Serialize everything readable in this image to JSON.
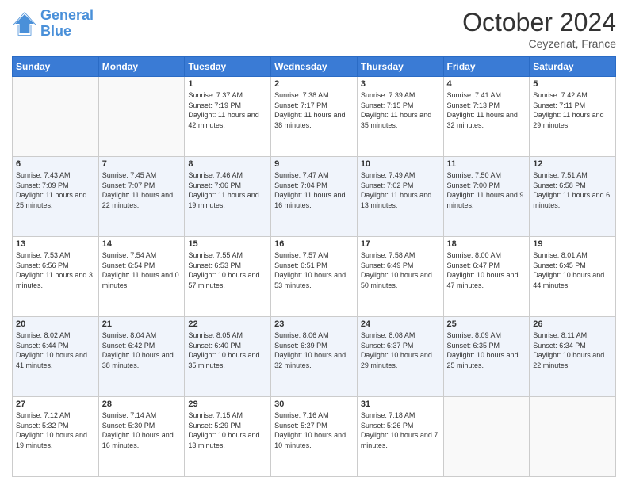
{
  "header": {
    "logo_line1": "General",
    "logo_line2": "Blue",
    "month": "October 2024",
    "location": "Ceyzeriat, France"
  },
  "weekdays": [
    "Sunday",
    "Monday",
    "Tuesday",
    "Wednesday",
    "Thursday",
    "Friday",
    "Saturday"
  ],
  "weeks": [
    [
      {
        "day": "",
        "sunrise": "",
        "sunset": "",
        "daylight": ""
      },
      {
        "day": "",
        "sunrise": "",
        "sunset": "",
        "daylight": ""
      },
      {
        "day": "1",
        "sunrise": "Sunrise: 7:37 AM",
        "sunset": "Sunset: 7:19 PM",
        "daylight": "Daylight: 11 hours and 42 minutes."
      },
      {
        "day": "2",
        "sunrise": "Sunrise: 7:38 AM",
        "sunset": "Sunset: 7:17 PM",
        "daylight": "Daylight: 11 hours and 38 minutes."
      },
      {
        "day": "3",
        "sunrise": "Sunrise: 7:39 AM",
        "sunset": "Sunset: 7:15 PM",
        "daylight": "Daylight: 11 hours and 35 minutes."
      },
      {
        "day": "4",
        "sunrise": "Sunrise: 7:41 AM",
        "sunset": "Sunset: 7:13 PM",
        "daylight": "Daylight: 11 hours and 32 minutes."
      },
      {
        "day": "5",
        "sunrise": "Sunrise: 7:42 AM",
        "sunset": "Sunset: 7:11 PM",
        "daylight": "Daylight: 11 hours and 29 minutes."
      }
    ],
    [
      {
        "day": "6",
        "sunrise": "Sunrise: 7:43 AM",
        "sunset": "Sunset: 7:09 PM",
        "daylight": "Daylight: 11 hours and 25 minutes."
      },
      {
        "day": "7",
        "sunrise": "Sunrise: 7:45 AM",
        "sunset": "Sunset: 7:07 PM",
        "daylight": "Daylight: 11 hours and 22 minutes."
      },
      {
        "day": "8",
        "sunrise": "Sunrise: 7:46 AM",
        "sunset": "Sunset: 7:06 PM",
        "daylight": "Daylight: 11 hours and 19 minutes."
      },
      {
        "day": "9",
        "sunrise": "Sunrise: 7:47 AM",
        "sunset": "Sunset: 7:04 PM",
        "daylight": "Daylight: 11 hours and 16 minutes."
      },
      {
        "day": "10",
        "sunrise": "Sunrise: 7:49 AM",
        "sunset": "Sunset: 7:02 PM",
        "daylight": "Daylight: 11 hours and 13 minutes."
      },
      {
        "day": "11",
        "sunrise": "Sunrise: 7:50 AM",
        "sunset": "Sunset: 7:00 PM",
        "daylight": "Daylight: 11 hours and 9 minutes."
      },
      {
        "day": "12",
        "sunrise": "Sunrise: 7:51 AM",
        "sunset": "Sunset: 6:58 PM",
        "daylight": "Daylight: 11 hours and 6 minutes."
      }
    ],
    [
      {
        "day": "13",
        "sunrise": "Sunrise: 7:53 AM",
        "sunset": "Sunset: 6:56 PM",
        "daylight": "Daylight: 11 hours and 3 minutes."
      },
      {
        "day": "14",
        "sunrise": "Sunrise: 7:54 AM",
        "sunset": "Sunset: 6:54 PM",
        "daylight": "Daylight: 11 hours and 0 minutes."
      },
      {
        "day": "15",
        "sunrise": "Sunrise: 7:55 AM",
        "sunset": "Sunset: 6:53 PM",
        "daylight": "Daylight: 10 hours and 57 minutes."
      },
      {
        "day": "16",
        "sunrise": "Sunrise: 7:57 AM",
        "sunset": "Sunset: 6:51 PM",
        "daylight": "Daylight: 10 hours and 53 minutes."
      },
      {
        "day": "17",
        "sunrise": "Sunrise: 7:58 AM",
        "sunset": "Sunset: 6:49 PM",
        "daylight": "Daylight: 10 hours and 50 minutes."
      },
      {
        "day": "18",
        "sunrise": "Sunrise: 8:00 AM",
        "sunset": "Sunset: 6:47 PM",
        "daylight": "Daylight: 10 hours and 47 minutes."
      },
      {
        "day": "19",
        "sunrise": "Sunrise: 8:01 AM",
        "sunset": "Sunset: 6:45 PM",
        "daylight": "Daylight: 10 hours and 44 minutes."
      }
    ],
    [
      {
        "day": "20",
        "sunrise": "Sunrise: 8:02 AM",
        "sunset": "Sunset: 6:44 PM",
        "daylight": "Daylight: 10 hours and 41 minutes."
      },
      {
        "day": "21",
        "sunrise": "Sunrise: 8:04 AM",
        "sunset": "Sunset: 6:42 PM",
        "daylight": "Daylight: 10 hours and 38 minutes."
      },
      {
        "day": "22",
        "sunrise": "Sunrise: 8:05 AM",
        "sunset": "Sunset: 6:40 PM",
        "daylight": "Daylight: 10 hours and 35 minutes."
      },
      {
        "day": "23",
        "sunrise": "Sunrise: 8:06 AM",
        "sunset": "Sunset: 6:39 PM",
        "daylight": "Daylight: 10 hours and 32 minutes."
      },
      {
        "day": "24",
        "sunrise": "Sunrise: 8:08 AM",
        "sunset": "Sunset: 6:37 PM",
        "daylight": "Daylight: 10 hours and 29 minutes."
      },
      {
        "day": "25",
        "sunrise": "Sunrise: 8:09 AM",
        "sunset": "Sunset: 6:35 PM",
        "daylight": "Daylight: 10 hours and 25 minutes."
      },
      {
        "day": "26",
        "sunrise": "Sunrise: 8:11 AM",
        "sunset": "Sunset: 6:34 PM",
        "daylight": "Daylight: 10 hours and 22 minutes."
      }
    ],
    [
      {
        "day": "27",
        "sunrise": "Sunrise: 7:12 AM",
        "sunset": "Sunset: 5:32 PM",
        "daylight": "Daylight: 10 hours and 19 minutes."
      },
      {
        "day": "28",
        "sunrise": "Sunrise: 7:14 AM",
        "sunset": "Sunset: 5:30 PM",
        "daylight": "Daylight: 10 hours and 16 minutes."
      },
      {
        "day": "29",
        "sunrise": "Sunrise: 7:15 AM",
        "sunset": "Sunset: 5:29 PM",
        "daylight": "Daylight: 10 hours and 13 minutes."
      },
      {
        "day": "30",
        "sunrise": "Sunrise: 7:16 AM",
        "sunset": "Sunset: 5:27 PM",
        "daylight": "Daylight: 10 hours and 10 minutes."
      },
      {
        "day": "31",
        "sunrise": "Sunrise: 7:18 AM",
        "sunset": "Sunset: 5:26 PM",
        "daylight": "Daylight: 10 hours and 7 minutes."
      },
      {
        "day": "",
        "sunrise": "",
        "sunset": "",
        "daylight": ""
      },
      {
        "day": "",
        "sunrise": "",
        "sunset": "",
        "daylight": ""
      }
    ]
  ]
}
